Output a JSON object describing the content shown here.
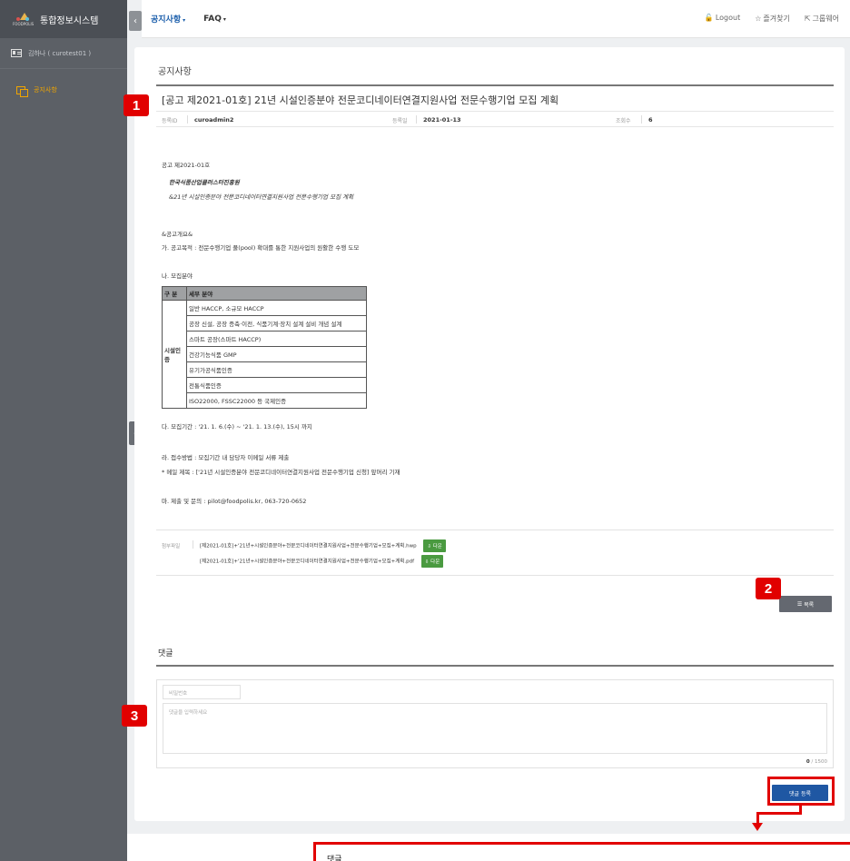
{
  "sidebar": {
    "logo_text": "FOODPOLIS",
    "title": "통합정보시스템",
    "user": "김하나 ( curotest01 )",
    "menu_item": "공지사항"
  },
  "topbar": {
    "nav1": "공지사항",
    "nav2": "FAQ",
    "logout": "Logout",
    "favorites": "즐겨찾기",
    "groupware": "그룹웨어"
  },
  "post": {
    "page_title": "공지사항",
    "title": "[공고 제2021-01호] 21년 시설인증분야 전문코디네이터연결지원사업 전문수행기업 모집 계획",
    "author_label": "등록ID",
    "author": "curoadmin2",
    "date_label": "등록일",
    "date": "2021-01-13",
    "views_label": "조회수",
    "views": "6",
    "body": {
      "line1": "공고 제2021-01호",
      "line2": "한국식품산업클러스터진흥원",
      "line3": "&21년 시설인증분야 전문코디네이터연결지원사업 전문수행기업 모집 계획",
      "line4": "&공고개요&",
      "line5": "가. 공고목적 : 전문수행기업 풀(pool) 확대를 통한 지원사업의 원활한 수행 도모",
      "line6": "나. 모집분야",
      "line7": "다. 모집기간 : '21. 1. 6.(수) ~ '21. 1. 13.(수), 15시 까지",
      "line8": "라. 접수방법 : 모집기간 내 담당자 이메일 서류 제출",
      "line9": "* 메일 제목 : ['21년 시설인증분야 전문코디네이터연결지원사업 전문수행기업 신청] 앞머리 기재",
      "line10": "마. 제출 및 문의 : pilot@foodpolis.kr, 063-720-0652"
    },
    "table": {
      "headers": [
        "구 분",
        "세부 분야"
      ],
      "category": "시설인증",
      "rows": [
        "일반 HACCP, 소규모 HACCP",
        "공장 신설, 공장 증축·이전, 식품기계·장치 설계 설비 개념 설계",
        "스마트 공장(스마트 HACCP)",
        "건강기능식품 GMP",
        "유기가공식품인증",
        "전통식품인증",
        "ISO22000, FSSC22000 등 국제인증"
      ]
    },
    "attachments_label": "첨부파일",
    "attachments": [
      "[제2021-01호]+'21년+시설인증분야+전문코디네이터연결지원사업+전문수행기업+모집+계획.hwp",
      "[제2021-01호]+'21년+시설인증분야+전문코디네이터연결지원사업+전문수행기업+모집+계획.pdf"
    ],
    "download_label": "다운",
    "list_button": "목록"
  },
  "comments": {
    "title": "댓글",
    "password_placeholder": "비밀번호",
    "comment_placeholder": "댓글을 입력하세요",
    "count_current": "0",
    "count_max": "/ 1500",
    "submit": "댓글 등록"
  },
  "annotations": {
    "badge1": "1",
    "badge2": "2",
    "badge3": "3",
    "lower_label": "댓글",
    "color": "#e10000"
  }
}
